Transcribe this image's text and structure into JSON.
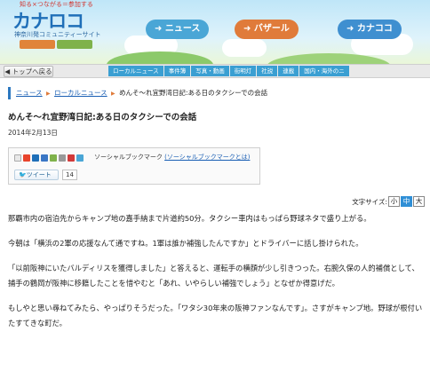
{
  "header": {
    "tagline": "知る×つながる＝参加する",
    "logo": "カナロコ",
    "subtitle": "神奈川発コミュニティーサイト",
    "pill_news": "ニュース",
    "pill_bazaar": "バザール",
    "pill_kanakoko": "カナココ"
  },
  "nav": {
    "back_label": "トップへ戻る",
    "tabs": [
      "ローカルニュース",
      "事件簿",
      "写真・動画",
      "街明灯",
      "社説",
      "連載",
      "国内・海外のニ"
    ]
  },
  "breadcrumb": {
    "items": [
      "ニュース",
      "ローカルニュース"
    ],
    "current": "めんそ～れ宜野湾日記:ある日のタクシーでの会話"
  },
  "article": {
    "title": "めんそ～れ宜野湾日記:ある日のタクシーでの会話",
    "date": "2014年2月13日",
    "paragraphs": [
      "那覇市内の宿泊先からキャンプ地の嘉手納まで片道約50分。タクシー車内はもっぱら野球ネタで盛り上がる。",
      "今朝は「横浜の2軍の応援なんて通ですね。1軍は誰か補強したんですか」とドライバーに話し掛けられた。",
      "「以前阪神にいたバルディリスを獲得しました」と答えると、運転手の横顔が少し引きつった。右腕久保の人的補償として、捕手の鶴岡が阪神に移籍したことを惜やむと「あれ、いやらしい補強でしょう」となぜか得意げだ。",
      "もしやと思い尋ねてみたら、やっぱりそうだった。「ワタシ30年来の阪神ファンなんです」。さすがキャンプ地。野球が根付いたすてきな町だ。"
    ]
  },
  "social": {
    "label": "ソーシャルブックマーク",
    "link": "(ソーシャルブックマークとは)",
    "tweet_label": "ツイート",
    "tweet_count": "14",
    "icon_colors": [
      "#e8e8e8",
      "#e8442c",
      "#1f6fb8",
      "#3a76c5",
      "#7fb24b",
      "#999999",
      "#d13a3a",
      "#4aa6d6"
    ]
  },
  "fontsize": {
    "label": "文字サイズ:",
    "small": "小",
    "medium": "中",
    "large": "大"
  }
}
